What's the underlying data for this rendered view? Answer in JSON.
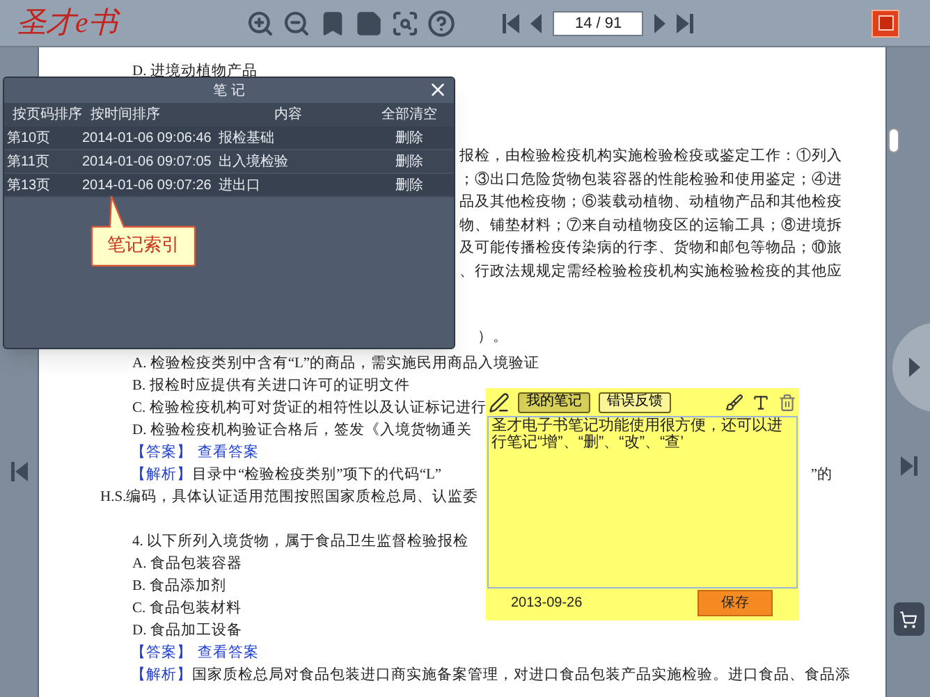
{
  "toolbar": {
    "logo": "圣才e书",
    "page_field": "14 / 91"
  },
  "page": {
    "lines": [
      {
        "kind": "option",
        "text": "D. 进境动植物产品"
      },
      {
        "kind": "fragment",
        "text": "报检，由检验检疫机构实施检验检疫或鉴定工作：①列入"
      },
      {
        "kind": "fragment",
        "text": "；③出口危险货物包装容器的性能检验和使用鉴定；④进"
      },
      {
        "kind": "fragment",
        "text": "品及其他检疫物；⑥装载动植物、动植物产品和其他检疫"
      },
      {
        "kind": "fragment",
        "text": "物、铺垫材料；⑦来自动植物疫区的运输工具；⑧进境拆"
      },
      {
        "kind": "fragment",
        "text": "及可能传播检疫传染病的行李、货物和邮包等物品；⑩旅"
      },
      {
        "kind": "fragment",
        "text": "、行政法规规定需经检验检疫机构实施检验检疫的其他应"
      },
      {
        "kind": "tail",
        "text": "）。"
      },
      {
        "kind": "option",
        "text": "A. 检验检疫类别中含有“L”的商品，需实施民用商品入境验证"
      },
      {
        "kind": "option",
        "text": "B. 报检时应提供有关进口许可的证明文件"
      },
      {
        "kind": "option",
        "text": "C. 检验检疫机构可对货证的相符性以及认证标记进行"
      },
      {
        "kind": "option",
        "text": "D. 检验检疫机构验证合格后，签发《入境货物通关"
      },
      {
        "kind": "answer",
        "label": "【答案】",
        "link": "查看答案"
      },
      {
        "kind": "analysis",
        "label": "【解析】",
        "text": "目录中“检验检疫类别”项下的代码“L”",
        "right": "”的"
      },
      {
        "kind": "wrap",
        "text": "H.S.编码，具体认证适用范围按照国家质检总局、认监委"
      },
      {
        "kind": "blank"
      },
      {
        "kind": "option",
        "text": "4. 以下所列入境货物，属于食品卫生监督检验报检"
      },
      {
        "kind": "option",
        "text": "A. 食品包装容器"
      },
      {
        "kind": "option",
        "text": "B. 食品添加剂"
      },
      {
        "kind": "option",
        "text": "C. 食品包装材料"
      },
      {
        "kind": "option",
        "text": "D. 食品加工设备"
      },
      {
        "kind": "answer",
        "label": "【答案】",
        "link": "查看答案"
      },
      {
        "kind": "analysis",
        "label": "【解析】",
        "text": "国家质检总局对食品包装进口商实施备案管理，对进口食品包装产品实施检验。进口食品、食品添"
      }
    ]
  },
  "notes_panel": {
    "title": "笔 记",
    "columns": [
      "按页码排序",
      "按时间排序",
      "内容",
      "全部清空"
    ],
    "rows": [
      {
        "page": "第10页",
        "time": "2014-01-06 09:06:46",
        "content": "报检基础",
        "action": "删除"
      },
      {
        "page": "第11页",
        "time": "2014-01-06 09:07:05",
        "content": "出入境检验",
        "action": "删除"
      },
      {
        "page": "第13页",
        "time": "2014-01-06 09:07:26",
        "content": "进出口",
        "action": "删除"
      }
    ],
    "callout": "笔记索引"
  },
  "sticky_note": {
    "tabs": [
      {
        "label": "我的笔记",
        "selected": true
      },
      {
        "label": "错误反馈",
        "selected": false
      }
    ],
    "text": "圣才电子书笔记功能使用很方便，还可以进行笔记“增”、“删”、“改”、“查’",
    "date": "2013-09-26",
    "save": "保存"
  }
}
